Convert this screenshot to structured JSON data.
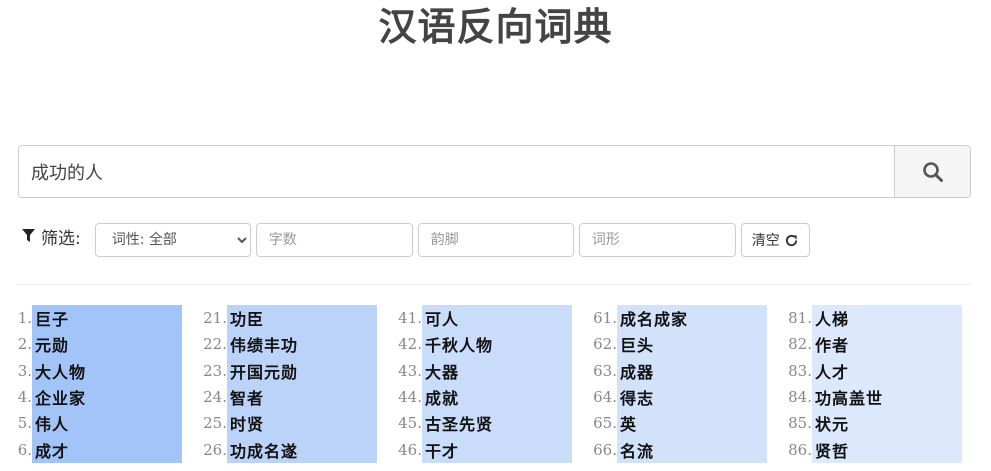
{
  "title": "汉语反向词典",
  "search": {
    "value": "成功的人"
  },
  "filter": {
    "label": "筛选:",
    "pos_select": "词性: 全部",
    "char_count_placeholder": "字数",
    "rhyme_placeholder": "韵脚",
    "form_placeholder": "词形",
    "clear_label": "清空"
  },
  "results": [
    {
      "color": "#a3c4f8",
      "items": [
        {
          "n": "1.",
          "w": "巨子"
        },
        {
          "n": "2.",
          "w": "元勋"
        },
        {
          "n": "3.",
          "w": "大人物"
        },
        {
          "n": "4.",
          "w": "企业家"
        },
        {
          "n": "5.",
          "w": "伟人"
        },
        {
          "n": "6.",
          "w": "成才"
        }
      ]
    },
    {
      "color": "#bcd3f9",
      "items": [
        {
          "n": "21.",
          "w": "功臣"
        },
        {
          "n": "22.",
          "w": "伟绩丰功"
        },
        {
          "n": "23.",
          "w": "开国元勋"
        },
        {
          "n": "24.",
          "w": "智者"
        },
        {
          "n": "25.",
          "w": "时贤"
        },
        {
          "n": "26.",
          "w": "功成名遂"
        }
      ]
    },
    {
      "color": "#c9dcfa",
      "items": [
        {
          "n": "41.",
          "w": "可人"
        },
        {
          "n": "42.",
          "w": "千秋人物"
        },
        {
          "n": "43.",
          "w": "大器"
        },
        {
          "n": "44.",
          "w": "成就"
        },
        {
          "n": "45.",
          "w": "古圣先贤"
        },
        {
          "n": "46.",
          "w": "干才"
        }
      ]
    },
    {
      "color": "#d3e2fb",
      "items": [
        {
          "n": "61.",
          "w": "成名成家"
        },
        {
          "n": "62.",
          "w": "巨头"
        },
        {
          "n": "63.",
          "w": "成器"
        },
        {
          "n": "64.",
          "w": "得志"
        },
        {
          "n": "65.",
          "w": "英"
        },
        {
          "n": "66.",
          "w": "名流"
        }
      ]
    },
    {
      "color": "#dce8fc",
      "items": [
        {
          "n": "81.",
          "w": "人梯"
        },
        {
          "n": "82.",
          "w": "作者"
        },
        {
          "n": "83.",
          "w": "人才"
        },
        {
          "n": "84.",
          "w": "功高盖世"
        },
        {
          "n": "85.",
          "w": "状元"
        },
        {
          "n": "86.",
          "w": "贤哲"
        }
      ]
    }
  ]
}
